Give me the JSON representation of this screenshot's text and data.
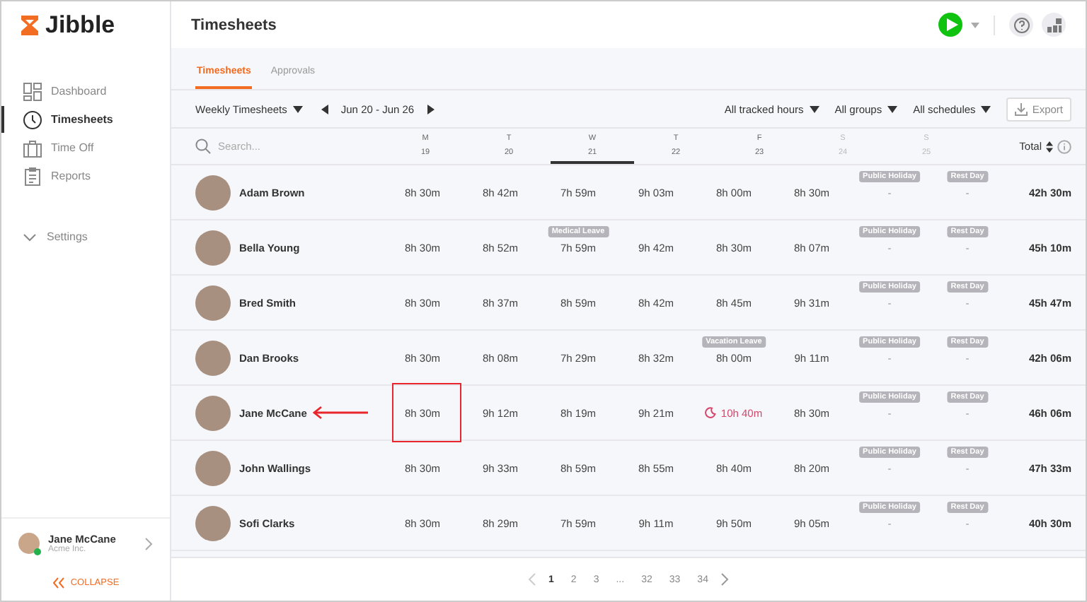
{
  "sidebar": {
    "logo": "Jibble",
    "items": [
      {
        "label": "Dashboard",
        "selected": false
      },
      {
        "label": "Timesheets",
        "selected": true
      },
      {
        "label": "Time Off",
        "selected": false
      },
      {
        "label": "Reports",
        "selected": false
      }
    ],
    "settings": "Settings",
    "user": {
      "name": "Jane McCane",
      "company": "Acme Inc.",
      "online": true
    },
    "collapse": "COLLAPSE"
  },
  "header": {
    "title": "Timesheets"
  },
  "tabs": [
    {
      "label": "Timesheets",
      "selected": true
    },
    {
      "label": "Approvals",
      "selected": false
    }
  ],
  "toolbar": {
    "view": "Weekly Timesheets",
    "range": "Jun 20 - Jun 26",
    "filters": [
      "All tracked hours",
      "All groups",
      "All schedules"
    ],
    "export": "Export"
  },
  "table": {
    "search_placeholder": "Search...",
    "total_label": "Total",
    "days": [
      {
        "letter": "M",
        "date": "19",
        "selected": false,
        "weekend": false
      },
      {
        "letter": "T",
        "date": "20",
        "selected": false,
        "weekend": false
      },
      {
        "letter": "W",
        "date": "21",
        "selected": true,
        "weekend": false
      },
      {
        "letter": "T",
        "date": "22",
        "selected": false,
        "weekend": false
      },
      {
        "letter": "F",
        "date": "23",
        "selected": false,
        "weekend": false
      },
      {
        "letter": "S",
        "date": "24",
        "selected": false,
        "weekend": true
      },
      {
        "letter": "S",
        "date": "25",
        "selected": false,
        "weekend": true
      }
    ],
    "rows": [
      {
        "name": "Adam Brown",
        "marked": false,
        "total": "42h 30m",
        "cells": [
          {
            "value": "8h 30m",
            "kind": "normal"
          },
          {
            "value": "8h 42m",
            "kind": "normal"
          },
          {
            "value": "7h 59m",
            "kind": "normal"
          },
          {
            "value": "9h 03m",
            "kind": "normal"
          },
          {
            "value": "8h 00m",
            "kind": "normal"
          },
          {
            "value": "8h 30m",
            "kind": "normal"
          },
          {
            "value": "-",
            "kind": "off",
            "badge": "Public Holiday"
          },
          {
            "value": "-",
            "kind": "off",
            "badge": "Rest Day"
          }
        ]
      },
      {
        "name": "Bella Young",
        "marked": false,
        "total": "45h 10m",
        "cells": [
          {
            "value": "8h 30m",
            "kind": "normal"
          },
          {
            "value": "8h 52m",
            "kind": "normal"
          },
          {
            "value": "7h 59m",
            "kind": "normal",
            "badge": "Medical Leave"
          },
          {
            "value": "9h 42m",
            "kind": "normal"
          },
          {
            "value": "8h 30m",
            "kind": "normal"
          },
          {
            "value": "8h 07m",
            "kind": "normal"
          },
          {
            "value": "-",
            "kind": "off",
            "badge": "Public Holiday"
          },
          {
            "value": "-",
            "kind": "off",
            "badge": "Rest Day"
          }
        ]
      },
      {
        "name": "Bred Smith",
        "marked": false,
        "total": "45h 47m",
        "cells": [
          {
            "value": "8h 30m",
            "kind": "normal"
          },
          {
            "value": "8h 37m",
            "kind": "normal"
          },
          {
            "value": "8h 59m",
            "kind": "normal"
          },
          {
            "value": "8h 42m",
            "kind": "normal"
          },
          {
            "value": "8h 45m",
            "kind": "normal"
          },
          {
            "value": "9h 31m",
            "kind": "normal"
          },
          {
            "value": "-",
            "kind": "off",
            "badge": "Public Holiday"
          },
          {
            "value": "-",
            "kind": "off",
            "badge": "Rest Day"
          }
        ]
      },
      {
        "name": "Dan Brooks",
        "marked": false,
        "total": "42h 06m",
        "cells": [
          {
            "value": "8h 30m",
            "kind": "normal"
          },
          {
            "value": "8h 08m",
            "kind": "normal"
          },
          {
            "value": "7h 29m",
            "kind": "normal"
          },
          {
            "value": "8h 32m",
            "kind": "normal"
          },
          {
            "value": "8h 00m",
            "kind": "normal",
            "badge": "Vacation Leave"
          },
          {
            "value": "9h 11m",
            "kind": "normal"
          },
          {
            "value": "-",
            "kind": "off",
            "badge": "Public Holiday"
          },
          {
            "value": "-",
            "kind": "off",
            "badge": "Rest Day"
          }
        ]
      },
      {
        "name": "Jane McCane",
        "marked": true,
        "total": "46h 06m",
        "cells": [
          {
            "value": "8h 30m",
            "kind": "normal"
          },
          {
            "value": "9h 12m",
            "kind": "normal"
          },
          {
            "value": "8h 19m",
            "kind": "normal"
          },
          {
            "value": "9h 21m",
            "kind": "normal"
          },
          {
            "value": "10h 40m",
            "kind": "overtime"
          },
          {
            "value": "8h 30m",
            "kind": "normal"
          },
          {
            "value": "-",
            "kind": "off",
            "badge": "Public Holiday"
          },
          {
            "value": "-",
            "kind": "off",
            "badge": "Rest Day"
          }
        ]
      },
      {
        "name": "John Wallings",
        "marked": false,
        "total": "47h 33m",
        "cells": [
          {
            "value": "8h 30m",
            "kind": "normal"
          },
          {
            "value": "9h 33m",
            "kind": "normal"
          },
          {
            "value": "8h 59m",
            "kind": "normal"
          },
          {
            "value": "8h 55m",
            "kind": "normal"
          },
          {
            "value": "8h 40m",
            "kind": "normal"
          },
          {
            "value": "8h 20m",
            "kind": "normal"
          },
          {
            "value": "-",
            "kind": "off",
            "badge": "Public Holiday"
          },
          {
            "value": "-",
            "kind": "off",
            "badge": "Rest Day"
          }
        ]
      },
      {
        "name": "Sofi Clarks",
        "marked": false,
        "total": "40h 30m",
        "cells": [
          {
            "value": "8h 30m",
            "kind": "normal"
          },
          {
            "value": "8h 29m",
            "kind": "normal"
          },
          {
            "value": "7h 59m",
            "kind": "normal"
          },
          {
            "value": "9h 11m",
            "kind": "normal"
          },
          {
            "value": "9h 50m",
            "kind": "normal"
          },
          {
            "value": "9h 05m",
            "kind": "normal"
          },
          {
            "value": "-",
            "kind": "off",
            "badge": "Public Holiday"
          },
          {
            "value": "-",
            "kind": "off",
            "badge": "Rest Day"
          }
        ]
      }
    ]
  },
  "pagination": [
    {
      "label": "1",
      "selected": true
    },
    {
      "label": "2",
      "selected": false
    },
    {
      "label": "3",
      "selected": false
    },
    {
      "label": "...",
      "selected": false
    },
    {
      "label": "32",
      "selected": false
    },
    {
      "label": "33",
      "selected": false
    },
    {
      "label": "34",
      "selected": false
    }
  ]
}
